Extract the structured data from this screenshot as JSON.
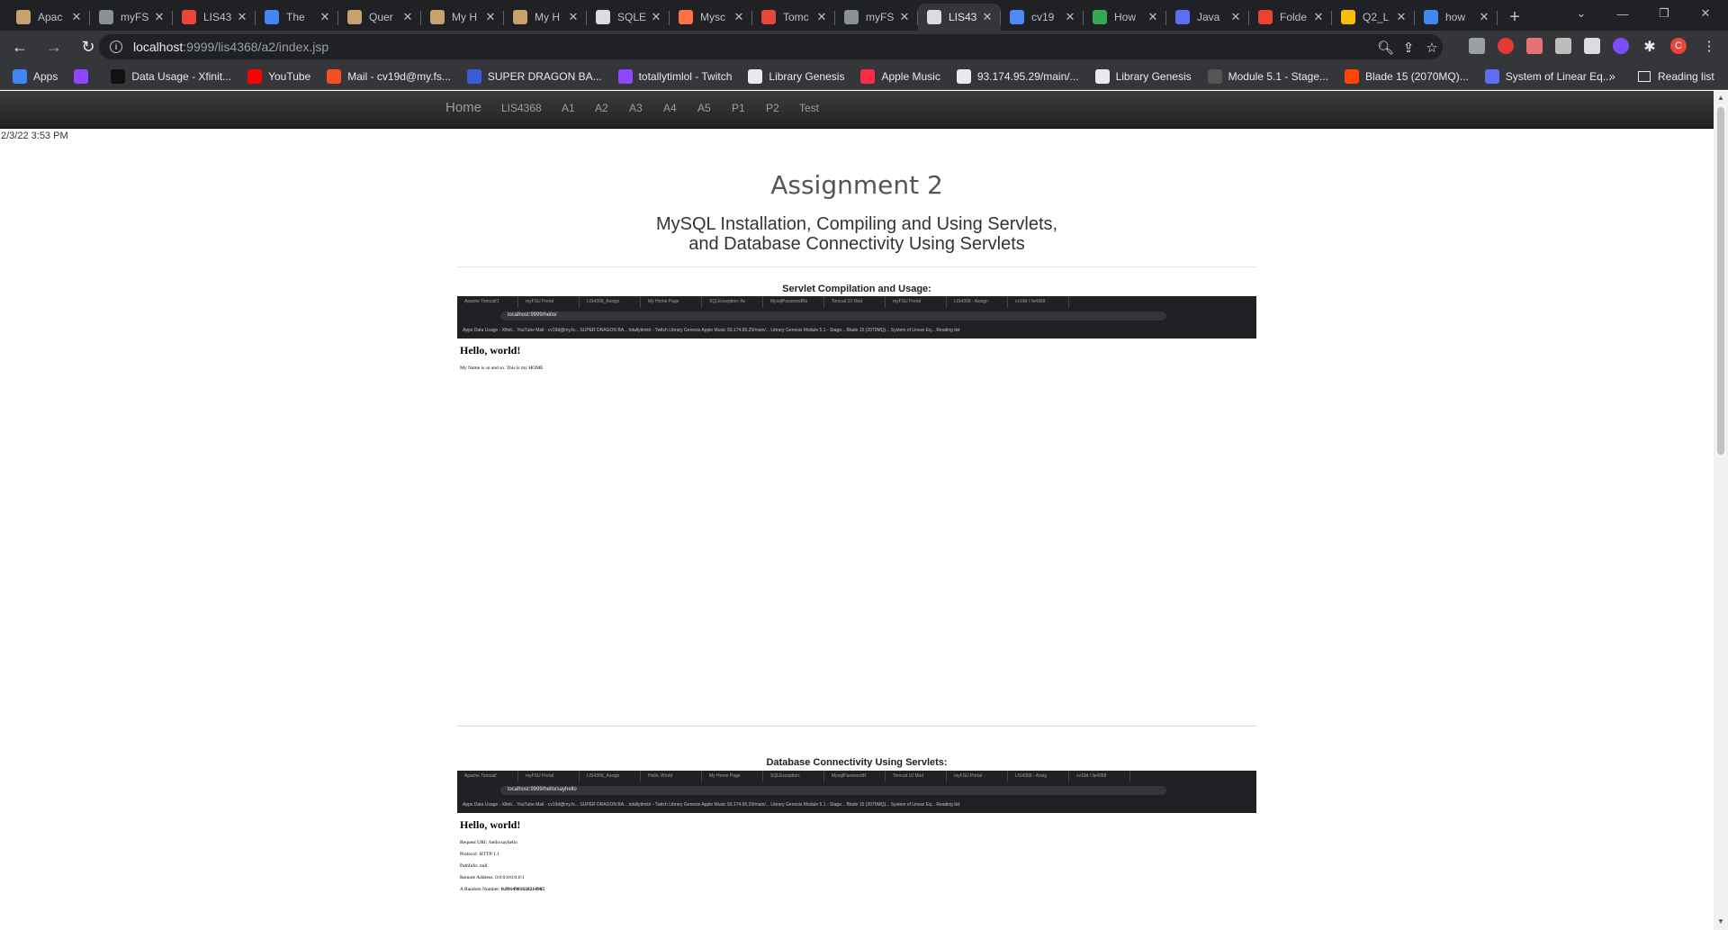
{
  "browser": {
    "tabs": [
      {
        "title": "Apac",
        "color": "#c9a070",
        "active": false
      },
      {
        "title": "myFS",
        "color": "#8a8f98",
        "active": false
      },
      {
        "title": "LIS43",
        "color": "#e8453c",
        "active": false
      },
      {
        "title": "The",
        "color": "#4285f4",
        "active": false
      },
      {
        "title": "Quer",
        "color": "#c9a070",
        "active": false
      },
      {
        "title": "My H",
        "color": "#c9a070",
        "active": false
      },
      {
        "title": "My H",
        "color": "#c9a070",
        "active": false
      },
      {
        "title": "SQLE",
        "color": "#dadce0",
        "active": false
      },
      {
        "title": "Mysc",
        "color": "#ff7043",
        "active": false
      },
      {
        "title": "Tomc",
        "color": "#e8453c",
        "active": false
      },
      {
        "title": "myFS",
        "color": "#8a8f98",
        "active": false
      },
      {
        "title": "LIS43",
        "color": "#dadce0",
        "active": true
      },
      {
        "title": "cv19",
        "color": "#4c8bf5",
        "active": false
      },
      {
        "title": "How",
        "color": "#34a853",
        "active": false
      },
      {
        "title": "Java",
        "color": "#5b6ef5",
        "active": false
      },
      {
        "title": "Folde",
        "color": "#ea4335",
        "active": false
      },
      {
        "title": "Q2_L",
        "color": "#fbbc04",
        "active": false
      },
      {
        "title": "how",
        "color": "#4285f4",
        "active": false
      }
    ],
    "new_tab": "+",
    "window": {
      "minimize": "—",
      "restore": "❐",
      "close": "✕",
      "tab_menu": "⌄"
    },
    "url_host": "localhost",
    "url_path": ":9999/lis4368/a2/index.jsp",
    "nav": {
      "back": "←",
      "forward": "→",
      "reload": "↻"
    },
    "bookmarks": [
      {
        "label": "Apps",
        "color": "#4285f4"
      },
      {
        "label": "",
        "color": "#9146ff"
      },
      {
        "label": "Data Usage - Xfinit...",
        "color": "#111111"
      },
      {
        "label": "YouTube",
        "color": "#ff0000"
      },
      {
        "label": "Mail - cv19d@my.fs...",
        "color": "#f25022"
      },
      {
        "label": "SUPER DRAGON BA...",
        "color": "#3b5bdb"
      },
      {
        "label": "totallytimlol - Twitch",
        "color": "#9146ff"
      },
      {
        "label": "Library Genesis",
        "color": "#e8eaed"
      },
      {
        "label": "Apple Music",
        "color": "#fa2d48"
      },
      {
        "label": "93.174.95.29/main/...",
        "color": "#e8eaed"
      },
      {
        "label": "Library Genesis",
        "color": "#e8eaed"
      },
      {
        "label": "Module 5.1 - Stage...",
        "color": "#555555"
      },
      {
        "label": "Blade 15 (2070MQ)...",
        "color": "#ff4500"
      },
      {
        "label": "System of Linear Eq...",
        "color": "#5b6ef5"
      }
    ],
    "bookmarks_more": "»",
    "reading_list": "Reading list"
  },
  "site_nav": {
    "brand": "Home",
    "links": [
      "LIS4368",
      "A1",
      "A2",
      "A3",
      "A4",
      "A5",
      "P1",
      "P2",
      "Test"
    ]
  },
  "timestamp": "2/3/22 3:53 PM",
  "main": {
    "title": "Assignment 2",
    "subtitle_line1": "MySQL Installation, Compiling and Using Servlets,",
    "subtitle_line2": "and Database Connectivity Using Servlets"
  },
  "section1": {
    "caption": "Servlet Compilation and Usage:",
    "shot_tabs": [
      "Apache Tomcat/1",
      "myFSU Portal",
      "LIS4368_Assign",
      "My Home Page",
      "SQLException: Ac",
      "MysqlPasswordRe",
      "Tomcat 10 Mod",
      "myFSU Portal",
      "LIS4368 - Assign",
      "cv19d / lis4368"
    ],
    "shot_url": "localhost:9999/hello/",
    "shot_bookmarks": "Apps   Data Usage - Xfinit...   YouTube   Mail - cv19d@my.fs...   SUPER DRAGON BA...   totallytimlol - Twitch   Library Genesis   Apple Music   93.174.95.29/main/...   Library Genesis   Module 5.1 - Stage...   Blade 15 (2070MQ)...   System of Linear Eq...      Reading list",
    "heading": "Hello, world!",
    "lines": [
      "My Name is so and so. This is my HOME"
    ]
  },
  "section2": {
    "caption": "Database Connectivity Using Servlets:",
    "shot_tabs": [
      "Apache Tomcat/",
      "myFSU Portal",
      "LIS4368_Assign",
      "Hello, World",
      "My Home Page",
      "SQLException:",
      "MysqlPasswordR",
      "Tomcat 10 Mod",
      "myFSU Portal",
      "LIS4368 - Assig",
      "cv19d / lis4368"
    ],
    "shot_url": "localhost:9999/hello/sayhello",
    "shot_bookmarks": "Apps   Data Usage - Xfinit...   YouTube   Mail - cv19d@my.fs...   SUPER DRAGON BA...   totallytimlol - Twitch   Library Genesis   Apple Music   93.174.95.29/main/...   Library Genesis   Module 5.1 - Stage...   Blade 15 (2070MQ)...   System of Linear Eq...      Reading list",
    "heading": "Hello, world!",
    "lines": [
      "Request URI: /hello/sayhello",
      "Protocol: HTTP/1.1",
      "PathInfo: null",
      "Remote Address: 0:0:0:0:0:0:0:1"
    ],
    "random_label": "A Random Number: ",
    "random_value": "0.8914981628214985"
  },
  "colors": {
    "chrome_dark": "#202124",
    "chrome_toolbar": "#35363a",
    "site_navbar": "#222222",
    "profile_avatar": "#e8453c"
  }
}
